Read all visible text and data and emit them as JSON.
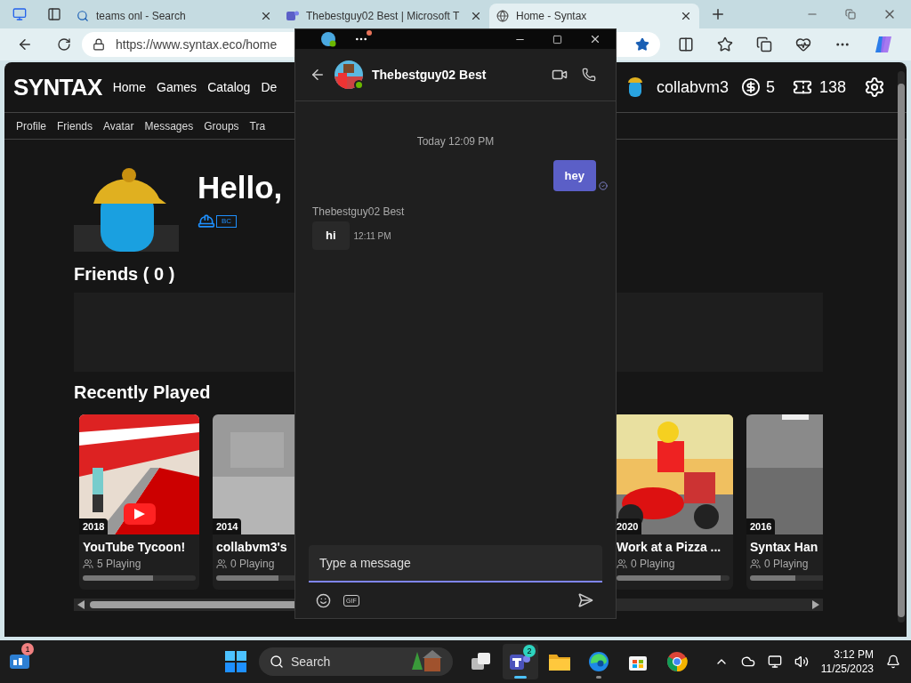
{
  "browser": {
    "tabs": [
      {
        "kind": "search",
        "title": "teams onl - Search",
        "selected": false
      },
      {
        "kind": "teams",
        "title": "Thebestguy02 Best | Microsoft T",
        "selected": false
      },
      {
        "kind": "syntax",
        "title": "Home - Syntax",
        "selected": true
      }
    ],
    "url": "https://www.syntax.eco/home",
    "favorite": true
  },
  "site": {
    "logo": "SYNTAX",
    "nav": [
      "Home",
      "Games",
      "Catalog",
      "De"
    ],
    "user": {
      "name": "collabvm3",
      "robux": "5",
      "tickets": "138"
    },
    "subnav": [
      "Profile",
      "Friends",
      "Avatar",
      "Messages",
      "Groups",
      "Tra"
    ],
    "greeting": "Hello,",
    "badge": "BC",
    "friends_title": "Friends ( 0 )",
    "recent_title": "Recently Played",
    "games": [
      {
        "year": "2018",
        "title": "YouTube Tycoon!",
        "players": "5 Playing",
        "level": 0.62
      },
      {
        "year": "2014",
        "title": "collabvm3's",
        "players": "0 Playing",
        "level": 0.55
      },
      {
        "year": "2020",
        "title": "Work at a Pizza ...",
        "players": "0 Playing",
        "level": 0.92
      },
      {
        "year": "2016",
        "title": "Syntax Han",
        "players": "0 Playing",
        "level": 0.4
      }
    ]
  },
  "teams": {
    "notification": true,
    "contact": {
      "name": "Thebestguy02 Best",
      "online": true
    },
    "date": "Today 12:09 PM",
    "messages": [
      {
        "kind": "sent",
        "text": "hey",
        "read": true
      },
      {
        "kind": "received",
        "sender": "Thebestguy02 Best",
        "text": "hi",
        "time": "12:11 PM"
      }
    ],
    "compose": {
      "placeholder": "Type a message"
    },
    "gif_label": "GIF"
  },
  "taskbar": {
    "widgets_badge": "1",
    "search": "Search",
    "apps": [
      {
        "kind": "taskview",
        "active": false,
        "running": false
      },
      {
        "kind": "teams",
        "badge": "2",
        "active": true,
        "running": true
      },
      {
        "kind": "files",
        "active": false,
        "running": false
      },
      {
        "kind": "edge",
        "active": false,
        "running": true
      },
      {
        "kind": "store",
        "active": false,
        "running": false
      },
      {
        "kind": "chrome",
        "active": false,
        "running": false
      }
    ],
    "time": "3:12 PM",
    "date": "11/25/2023"
  }
}
